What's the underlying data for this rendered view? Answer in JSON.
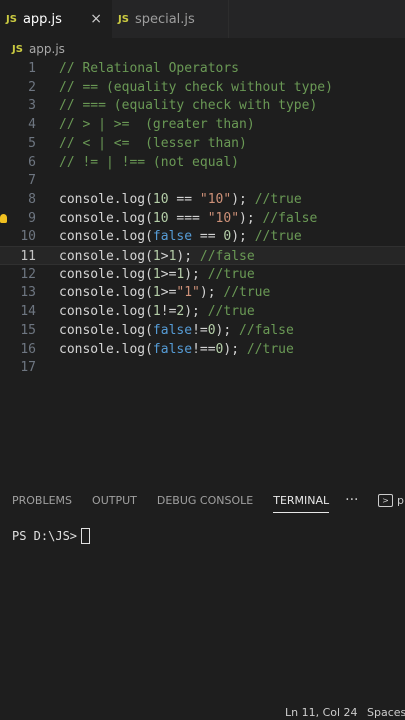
{
  "tabs": [
    {
      "badge": "JS",
      "label": "app.js",
      "close": "×"
    },
    {
      "badge": "JS",
      "label": "special.js"
    }
  ],
  "breadcrumb": {
    "badge": "JS",
    "file": "app.js"
  },
  "code_lines": [
    {
      "n": "1",
      "tokens": [
        {
          "t": "// Relational Operators",
          "k": "comment"
        }
      ]
    },
    {
      "n": "2",
      "tokens": [
        {
          "t": "// == (equality check without type)",
          "k": "comment"
        }
      ]
    },
    {
      "n": "3",
      "tokens": [
        {
          "t": "// === (equality check with type)",
          "k": "comment"
        }
      ]
    },
    {
      "n": "4",
      "tokens": [
        {
          "t": "// > | >=  (greater than)",
          "k": "comment"
        }
      ]
    },
    {
      "n": "5",
      "tokens": [
        {
          "t": "// < | <=  (lesser than)",
          "k": "comment"
        }
      ]
    },
    {
      "n": "6",
      "tokens": [
        {
          "t": "// != | !== (not equal)",
          "k": "comment"
        }
      ]
    },
    {
      "n": "7",
      "tokens": []
    },
    {
      "n": "8",
      "tokens": [
        {
          "t": "console.log(",
          "k": "plain"
        },
        {
          "t": "10",
          "k": "num"
        },
        {
          "t": " == ",
          "k": "plain"
        },
        {
          "t": "\"10\"",
          "k": "str"
        },
        {
          "t": "); ",
          "k": "plain"
        },
        {
          "t": "//true",
          "k": "comment"
        }
      ]
    },
    {
      "n": "9",
      "tokens": [
        {
          "t": "console.log(",
          "k": "plain"
        },
        {
          "t": "10",
          "k": "num"
        },
        {
          "t": " === ",
          "k": "plain"
        },
        {
          "t": "\"10\"",
          "k": "str"
        },
        {
          "t": "); ",
          "k": "plain"
        },
        {
          "t": "//false",
          "k": "comment"
        }
      ]
    },
    {
      "n": "10",
      "tokens": [
        {
          "t": "console.log(",
          "k": "plain"
        },
        {
          "t": "false",
          "k": "kw"
        },
        {
          "t": " == ",
          "k": "plain"
        },
        {
          "t": "0",
          "k": "num"
        },
        {
          "t": "); ",
          "k": "plain"
        },
        {
          "t": "//true",
          "k": "comment"
        }
      ]
    },
    {
      "n": "11",
      "tokens": [
        {
          "t": "console.log(",
          "k": "plain"
        },
        {
          "t": "1",
          "k": "num"
        },
        {
          "t": ">",
          "k": "plain"
        },
        {
          "t": "1",
          "k": "num"
        },
        {
          "t": "); ",
          "k": "plain"
        },
        {
          "t": "//false",
          "k": "comment"
        }
      ]
    },
    {
      "n": "12",
      "tokens": [
        {
          "t": "console.log(",
          "k": "plain"
        },
        {
          "t": "1",
          "k": "num"
        },
        {
          "t": ">=",
          "k": "plain"
        },
        {
          "t": "1",
          "k": "num"
        },
        {
          "t": "); ",
          "k": "plain"
        },
        {
          "t": "//true",
          "k": "comment"
        }
      ]
    },
    {
      "n": "13",
      "tokens": [
        {
          "t": "console.log(",
          "k": "plain"
        },
        {
          "t": "1",
          "k": "num"
        },
        {
          "t": ">=",
          "k": "plain"
        },
        {
          "t": "\"1\"",
          "k": "str"
        },
        {
          "t": "); ",
          "k": "plain"
        },
        {
          "t": "//true",
          "k": "comment"
        }
      ]
    },
    {
      "n": "14",
      "tokens": [
        {
          "t": "console.log(",
          "k": "plain"
        },
        {
          "t": "1",
          "k": "num"
        },
        {
          "t": "!=",
          "k": "plain"
        },
        {
          "t": "2",
          "k": "num"
        },
        {
          "t": "); ",
          "k": "plain"
        },
        {
          "t": "//true",
          "k": "comment"
        }
      ]
    },
    {
      "n": "15",
      "tokens": [
        {
          "t": "console.log(",
          "k": "plain"
        },
        {
          "t": "false",
          "k": "kw"
        },
        {
          "t": "!=",
          "k": "plain"
        },
        {
          "t": "0",
          "k": "num"
        },
        {
          "t": "); ",
          "k": "plain"
        },
        {
          "t": "//false",
          "k": "comment"
        }
      ]
    },
    {
      "n": "16",
      "tokens": [
        {
          "t": "console.log(",
          "k": "plain"
        },
        {
          "t": "false",
          "k": "kw"
        },
        {
          "t": "!==",
          "k": "plain"
        },
        {
          "t": "0",
          "k": "num"
        },
        {
          "t": "); ",
          "k": "plain"
        },
        {
          "t": "//true",
          "k": "comment"
        }
      ]
    },
    {
      "n": "17",
      "tokens": []
    }
  ],
  "current_line": "11",
  "lightbulb_line": "9",
  "panel": {
    "tabs": [
      "PROBLEMS",
      "OUTPUT",
      "DEBUG CONSOLE",
      "TERMINAL"
    ],
    "active_tab": "TERMINAL",
    "more": "···",
    "right_label": "p"
  },
  "terminal": {
    "prompt": "PS D:\\JS>"
  },
  "statusbar": {
    "position": "Ln 11, Col 24",
    "spaces": "Spaces"
  },
  "colors": {
    "editor_bg": "#1e1e1e",
    "comment": "#6a9955",
    "number": "#b5cea8",
    "string": "#ce9178",
    "keyword": "#569cd6",
    "js_badge": "#cbcb41"
  }
}
